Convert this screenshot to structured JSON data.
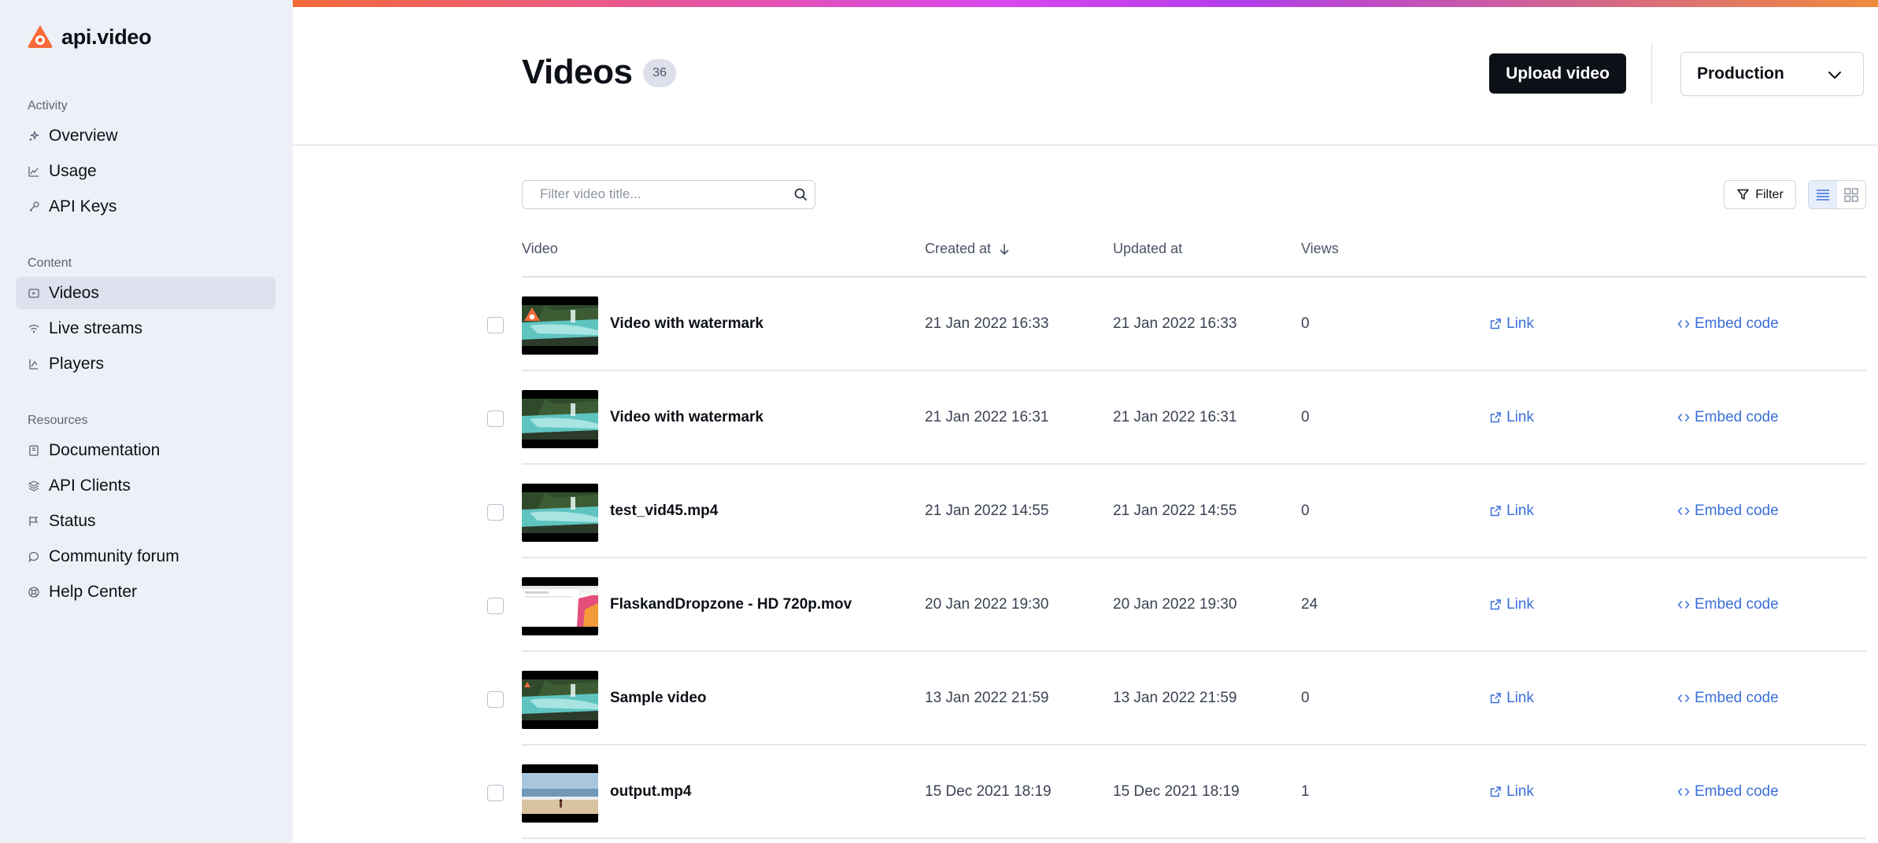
{
  "app": {
    "name": "api.video"
  },
  "sidebar": {
    "sections": [
      {
        "heading": "Activity",
        "items": [
          {
            "label": "Overview",
            "icon": "sparkle-icon"
          },
          {
            "label": "Usage",
            "icon": "chart-icon"
          },
          {
            "label": "API Keys",
            "icon": "key-icon"
          }
        ]
      },
      {
        "heading": "Content",
        "items": [
          {
            "label": "Videos",
            "icon": "video-icon",
            "active": true
          },
          {
            "label": "Live streams",
            "icon": "wifi-icon"
          },
          {
            "label": "Players",
            "icon": "player-icon"
          }
        ]
      },
      {
        "heading": "Resources",
        "items": [
          {
            "label": "Documentation",
            "icon": "book-icon"
          },
          {
            "label": "API Clients",
            "icon": "layers-icon"
          },
          {
            "label": "Status",
            "icon": "flag-icon"
          },
          {
            "label": "Community forum",
            "icon": "chat-icon"
          },
          {
            "label": "Help Center",
            "icon": "lifebuoy-icon"
          }
        ]
      }
    ]
  },
  "header": {
    "title": "Videos",
    "count": "36",
    "upload_label": "Upload video",
    "environment": "Production"
  },
  "toolbar": {
    "search_placeholder": "Filter video title...",
    "filter_label": "Filter"
  },
  "table": {
    "columns": {
      "video": "Video",
      "created": "Created at",
      "updated": "Updated at",
      "views": "Views"
    },
    "rows": [
      {
        "title": "Video with watermark",
        "created": "21 Jan 2022 16:33",
        "updated": "21 Jan 2022 16:33",
        "views": "0",
        "link": "Link",
        "embed": "Embed code",
        "thumb": "waterfall-watermark"
      },
      {
        "title": "Video with watermark",
        "created": "21 Jan 2022 16:31",
        "updated": "21 Jan 2022 16:31",
        "views": "0",
        "link": "Link",
        "embed": "Embed code",
        "thumb": "waterfall"
      },
      {
        "title": "test_vid45.mp4",
        "created": "21 Jan 2022 14:55",
        "updated": "21 Jan 2022 14:55",
        "views": "0",
        "link": "Link",
        "embed": "Embed code",
        "thumb": "waterfall"
      },
      {
        "title": "FlaskandDropzone - HD 720p.mov",
        "created": "20 Jan 2022 19:30",
        "updated": "20 Jan 2022 19:30",
        "views": "24",
        "link": "Link",
        "embed": "Embed code",
        "thumb": "screen"
      },
      {
        "title": "Sample video",
        "created": "13 Jan 2022 21:59",
        "updated": "13 Jan 2022 21:59",
        "views": "0",
        "link": "Link",
        "embed": "Embed code",
        "thumb": "waterfall-dot"
      },
      {
        "title": "output.mp4",
        "created": "15 Dec 2021 18:19",
        "updated": "15 Dec 2021 18:19",
        "views": "1",
        "link": "Link",
        "embed": "Embed code",
        "thumb": "beach"
      }
    ]
  },
  "colors": {
    "brand": "#f56b3a",
    "link": "#3b6fd9",
    "sidebar_bg": "#eef0f7",
    "primary_button": "#0d1117"
  }
}
